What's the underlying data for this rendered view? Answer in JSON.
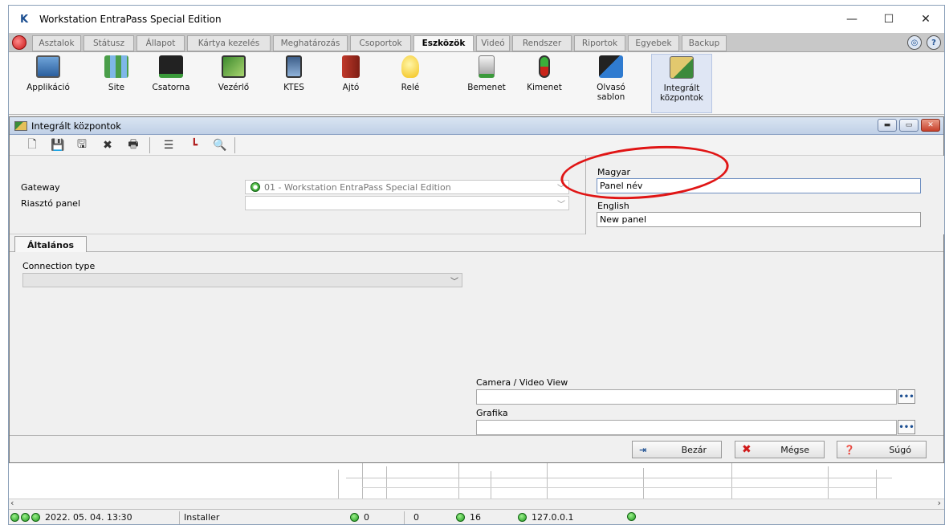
{
  "window": {
    "title": "Workstation EntraPass Special Edition",
    "controls": [
      "—",
      "☐",
      "✕"
    ]
  },
  "tabs": [
    {
      "label": "Asztalok"
    },
    {
      "label": "Státusz"
    },
    {
      "label": "Állapot"
    },
    {
      "label": "Kártya kezelés"
    },
    {
      "label": "Meghatározás"
    },
    {
      "label": "Csoportok"
    },
    {
      "label": "Eszközök",
      "active": true
    },
    {
      "label": "Videó"
    },
    {
      "label": "Rendszer"
    },
    {
      "label": "Riportok"
    },
    {
      "label": "Egyebek"
    },
    {
      "label": "Backup"
    }
  ],
  "ribbon": [
    {
      "label": "Applikáció",
      "icon": "monitor-icon"
    },
    {
      "label": "Site",
      "icon": "site-network-icon"
    },
    {
      "label": "Csatorna",
      "icon": "channel-icon"
    },
    {
      "label": "Vezérlő",
      "icon": "controller-board-icon"
    },
    {
      "label": "KTES",
      "icon": "ktes-icon"
    },
    {
      "label": "Ajtó",
      "icon": "door-icon"
    },
    {
      "label": "Relé",
      "icon": "lightbulb-icon"
    },
    {
      "label": "Bemenet",
      "icon": "input-icon"
    },
    {
      "label": "Kimenet",
      "icon": "traffic-light-icon"
    },
    {
      "label": "Olvasó sablon",
      "icon": "reader-template-icon"
    },
    {
      "label": "Integrált központok",
      "icon": "integrated-panel-icon",
      "active": true
    }
  ],
  "subwindow": {
    "title": "Integrált központok"
  },
  "toolbar": [
    "new-icon",
    "save-icon",
    "save-as-icon",
    "delete-icon",
    "print-icon",
    "list-icon",
    "link-icon",
    "search-icon"
  ],
  "form": {
    "gateway_label": "Gateway",
    "gateway_value": "01 - Workstation EntraPass Special Edition",
    "alarm_panel_label": "Riasztó panel",
    "alarm_panel_value": "",
    "lang1_label": "Magyar",
    "lang1_value": "Panel név",
    "lang2_label": "English",
    "lang2_value": "New panel"
  },
  "general_tab": {
    "label": "Általános",
    "connection_type_label": "Connection type",
    "connection_type_value": "",
    "camera_label": "Camera / Video View",
    "camera_value": "",
    "graphics_label": "Grafika",
    "graphics_value": "",
    "browse_label": "•••"
  },
  "buttons": {
    "close": "Bezár",
    "cancel": "Mégse",
    "help": "Súgó"
  },
  "status_bar": {
    "datetime": "2022. 05. 04. 13:30",
    "user": "Installer",
    "count1": "0",
    "count2": "0",
    "count3": "16",
    "ip": "127.0.0.1"
  },
  "colors": {
    "highlight_ring": "#e01515",
    "active_tab_bg": "#dfe6f4",
    "status_green": "#1f9a1f"
  }
}
